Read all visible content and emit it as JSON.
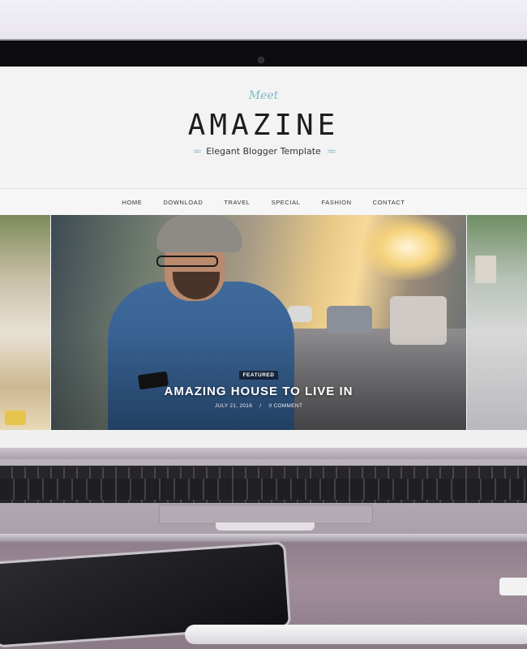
{
  "site": {
    "meet": "Meet",
    "logo": "AMAZINE",
    "tagline": "Elegant Blogger Template",
    "sprig_left": "≈≈",
    "sprig_right": "≈≈"
  },
  "nav": {
    "items": [
      {
        "label": "HOME"
      },
      {
        "label": "DOWNLOAD"
      },
      {
        "label": "TRAVEL"
      },
      {
        "label": "SPECIAL"
      },
      {
        "label": "FASHION"
      },
      {
        "label": "CONTACT"
      }
    ]
  },
  "slider": {
    "badge": "FEATURED",
    "title": "AMAZING HOUSE TO LIVE IN",
    "date": "JULY 21, 2016",
    "separator": "/",
    "comments": "0 COMMENT"
  },
  "colors": {
    "accent": "#7fb7c4",
    "logo": "#1d1d1f"
  }
}
